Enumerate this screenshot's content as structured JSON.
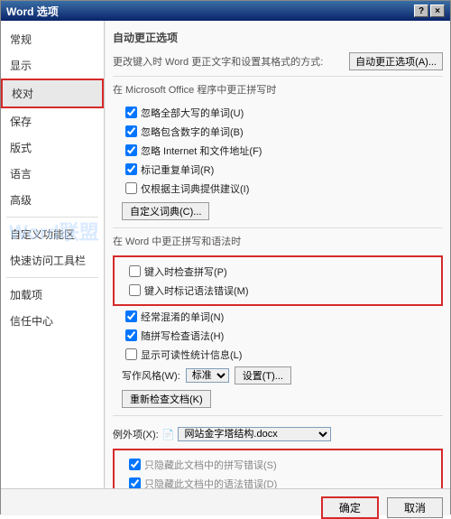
{
  "title": "Word 选项",
  "winbtns": {
    "help": "?",
    "close": "×"
  },
  "sidebar": {
    "items": [
      {
        "label": "常规"
      },
      {
        "label": "显示"
      },
      {
        "label": "校对",
        "selected": true
      },
      {
        "label": "保存"
      },
      {
        "label": "版式"
      },
      {
        "label": "语言"
      },
      {
        "label": "高级"
      }
    ],
    "group2": [
      {
        "label": "自定义功能区"
      },
      {
        "label": "快速访问工具栏"
      }
    ],
    "group3": [
      {
        "label": "加载项"
      },
      {
        "label": "信任中心"
      }
    ]
  },
  "sections": {
    "autocorrect_head": "自动更正选项",
    "autocorrect_line": "更改键入时 Word 更正文字和设置其格式的方式:",
    "autocorrect_btn": "自动更正选项(A)...",
    "office_head": "在 Microsoft Office 程序中更正拼写时",
    "office_opts": [
      {
        "label": "忽略全部大写的单词(U)",
        "checked": true
      },
      {
        "label": "忽略包含数字的单词(B)",
        "checked": true
      },
      {
        "label": "忽略 Internet 和文件地址(F)",
        "checked": true
      },
      {
        "label": "标记重复单词(R)",
        "checked": true
      },
      {
        "label": "仅根据主词典提供建议(I)",
        "checked": false
      }
    ],
    "dict_btn": "自定义词典(C)...",
    "word_head": "在 Word 中更正拼写和语法时",
    "redbox_opts": [
      {
        "label": "键入时检查拼写(P)",
        "checked": false
      },
      {
        "label": "键入时标记语法错误(M)",
        "checked": false
      }
    ],
    "word_opts_after": [
      {
        "label": "经常混淆的单词(N)",
        "checked": true
      },
      {
        "label": "随拼写检查语法(H)",
        "checked": true
      },
      {
        "label": "显示可读性统计信息(L)",
        "checked": false
      }
    ],
    "style_label": "写作风格(W):",
    "style_select": "标准",
    "settings_btn": "设置(T)...",
    "recheck_btn": "重新检查文档(K)",
    "except_label": "例外项(X):",
    "except_select": "网站金字塔结构.docx",
    "except_opts": [
      {
        "label": "只隐藏此文档中的拼写错误(S)",
        "checked": true,
        "grey": true
      },
      {
        "label": "只隐藏此文档中的语法错误(D)",
        "checked": true,
        "grey": true
      }
    ]
  },
  "footer": {
    "ok": "确定",
    "cancel": "取消"
  }
}
